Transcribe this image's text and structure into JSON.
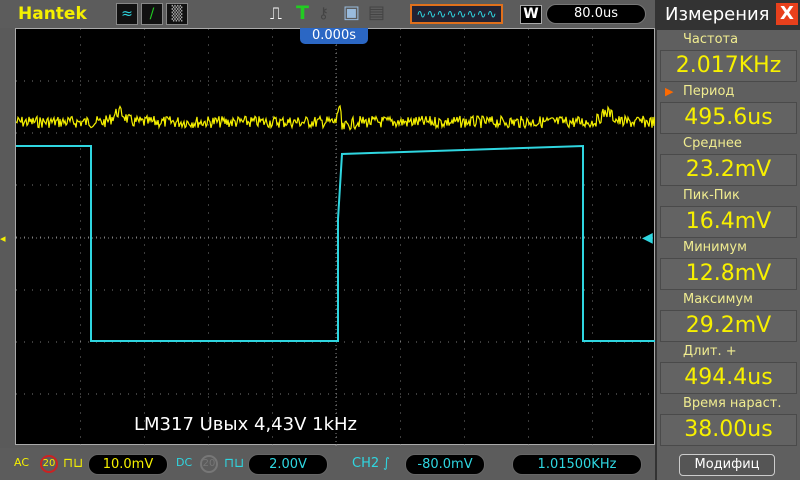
{
  "header": {
    "brand": "Hantek",
    "timebase": "80.0us",
    "trigger_position": "0.000s",
    "mode_letter": "W",
    "trigger_letter": "T"
  },
  "caption": "LM317 Uвых 4,43V 1kHz",
  "bottom": {
    "ch1_coupling": "AC",
    "ch1_bw": "20",
    "ch1_scale": "10.0mV",
    "ch2_coupling": "DC",
    "ch2_bw": "20",
    "ch2_scale": "2.00V",
    "trigger_source": "CH2",
    "trigger_level": "-80.0mV",
    "frequency": "1.01500KHz"
  },
  "measurements": {
    "title": "Измерения",
    "close": "X",
    "items": [
      {
        "label": "Частота",
        "value": "2.017KHz"
      },
      {
        "label": "Период",
        "value": "495.6us",
        "selected": true
      },
      {
        "label": "Среднее",
        "value": "23.2mV"
      },
      {
        "label": "Пик-Пик",
        "value": "16.4mV"
      },
      {
        "label": "Минимум",
        "value": "12.8mV"
      },
      {
        "label": "Максимум",
        "value": "29.2mV"
      },
      {
        "label": "Длит. +",
        "value": "494.4us"
      },
      {
        "label": "Время нараст.",
        "value": "38.00us"
      }
    ],
    "modify_button": "Модифиц"
  },
  "colors": {
    "ch1": "#f5f000",
    "ch2": "#2fd6e0",
    "panel": "#5f5f5f"
  }
}
